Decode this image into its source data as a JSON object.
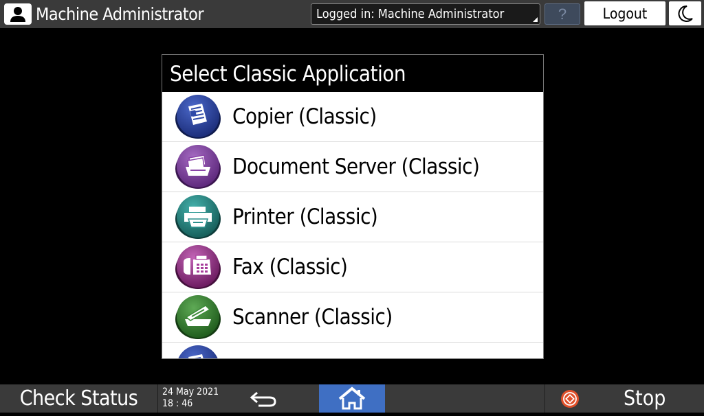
{
  "header": {
    "user_title": "Machine Administrator",
    "login_status": "Logged in: Machine Administrator",
    "help_label": "?",
    "logout_label": "Logout"
  },
  "dialog": {
    "title": "Select Classic Application",
    "items": [
      {
        "label": "Copier (Classic)",
        "icon": "copier-icon",
        "color": "#2f4aa8"
      },
      {
        "label": "Document Server (Classic)",
        "icon": "document-server-icon",
        "color": "#8a45a8"
      },
      {
        "label": "Printer (Classic)",
        "icon": "printer-icon",
        "color": "#2a8f8c"
      },
      {
        "label": "Fax (Classic)",
        "icon": "fax-icon",
        "color": "#a73d9b"
      },
      {
        "label": "Scanner (Classic)",
        "icon": "scanner-icon",
        "color": "#3b8a37"
      }
    ]
  },
  "footer": {
    "check_status_label": "Check Status",
    "date": "24 May 2021",
    "time": "18 : 46",
    "stop_label": "Stop"
  },
  "colors": {
    "bar_background": "#3a3a3a",
    "home_button": "#3f6fc3",
    "stop_icon": "#e0502a"
  }
}
